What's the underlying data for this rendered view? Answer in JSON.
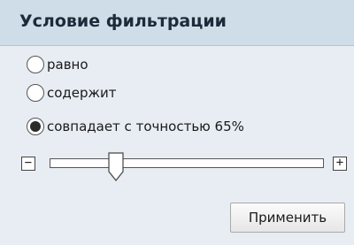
{
  "panel": {
    "title": "Условие фильтрации"
  },
  "options": [
    {
      "label": "равно",
      "selected": false
    },
    {
      "label": "содержит",
      "selected": false
    },
    {
      "label": "совпадает с точностью 65%",
      "selected": true
    }
  ],
  "slider": {
    "value_percent": 65,
    "decrement_symbol": "−",
    "increment_symbol": "+"
  },
  "apply_button": {
    "label": "Применить"
  }
}
